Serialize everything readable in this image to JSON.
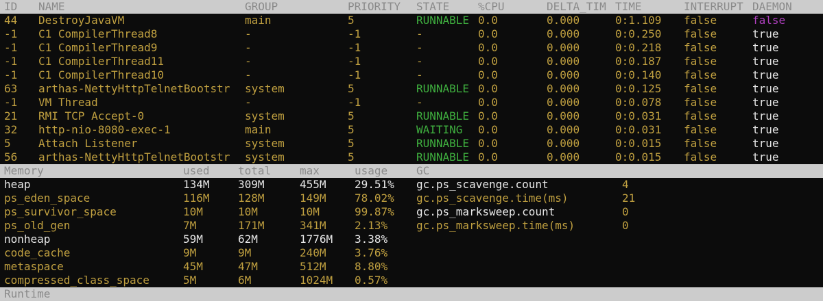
{
  "thread_table": {
    "columns": [
      "ID",
      "NAME",
      "GROUP",
      "PRIORITY",
      "STATE",
      "%CPU",
      "DELTA_TIM",
      "TIME",
      "INTERRUPT",
      "DAEMON"
    ],
    "rows": [
      [
        "44",
        "DestroyJavaVM",
        "main",
        "5",
        "RUNNABLE",
        "0.0",
        "0.000",
        "0:1.109",
        "false",
        "false"
      ],
      [
        "-1",
        "C1 CompilerThread8",
        "-",
        "-1",
        "-",
        "0.0",
        "0.000",
        "0:0.250",
        "false",
        "true"
      ],
      [
        "-1",
        "C1 CompilerThread9",
        "-",
        "-1",
        "-",
        "0.0",
        "0.000",
        "0:0.218",
        "false",
        "true"
      ],
      [
        "-1",
        "C1 CompilerThread11",
        "-",
        "-1",
        "-",
        "0.0",
        "0.000",
        "0:0.187",
        "false",
        "true"
      ],
      [
        "-1",
        "C1 CompilerThread10",
        "-",
        "-1",
        "-",
        "0.0",
        "0.000",
        "0:0.140",
        "false",
        "true"
      ],
      [
        "63",
        "arthas-NettyHttpTelnetBootstr",
        "system",
        "5",
        "RUNNABLE",
        "0.0",
        "0.000",
        "0:0.125",
        "false",
        "true"
      ],
      [
        "-1",
        "VM Thread",
        "-",
        "-1",
        "-",
        "0.0",
        "0.000",
        "0:0.078",
        "false",
        "true"
      ],
      [
        "21",
        "RMI TCP Accept-0",
        "system",
        "5",
        "RUNNABLE",
        "0.0",
        "0.000",
        "0:0.031",
        "false",
        "true"
      ],
      [
        "32",
        "http-nio-8080-exec-1",
        "main",
        "5",
        "WAITING",
        "0.0",
        "0.000",
        "0:0.031",
        "false",
        "true"
      ],
      [
        "5",
        "Attach Listener",
        "system",
        "5",
        "RUNNABLE",
        "0.0",
        "0.000",
        "0:0.015",
        "false",
        "true"
      ],
      [
        "56",
        "arthas-NettyHttpTelnetBootstr",
        "system",
        "5",
        "RUNNABLE",
        "0.0",
        "0.000",
        "0:0.015",
        "false",
        "true"
      ]
    ]
  },
  "memory_table": {
    "columns": [
      "Memory",
      "used",
      "total",
      "max",
      "usage"
    ],
    "rows": [
      [
        "heap",
        "134M",
        "309M",
        "455M",
        "29.51%"
      ],
      [
        "ps_eden_space",
        "116M",
        "128M",
        "149M",
        "78.02%"
      ],
      [
        "ps_survivor_space",
        "10M",
        "10M",
        "10M",
        "99.87%"
      ],
      [
        "ps_old_gen",
        "7M",
        "171M",
        "341M",
        "2.13%"
      ],
      [
        "nonheap",
        "59M",
        "62M",
        "1776M",
        "3.38%"
      ],
      [
        "code_cache",
        "9M",
        "9M",
        "240M",
        "3.76%"
      ],
      [
        "metaspace",
        "45M",
        "47M",
        "512M",
        "8.80%"
      ],
      [
        "compressed_class_space",
        "5M",
        "6M",
        "1024M",
        "0.57%"
      ]
    ]
  },
  "gc_table": {
    "header": "GC",
    "rows": [
      [
        "gc.ps_scavenge.count",
        "4"
      ],
      [
        "gc.ps_scavenge.time(ms)",
        "21"
      ],
      [
        "gc.ps_marksweep.count",
        "0"
      ],
      [
        "gc.ps_marksweep.time(ms)",
        "0"
      ]
    ]
  },
  "runtime_section": {
    "header": "Runtime"
  },
  "colors": {
    "header_bg": "#cccccc",
    "header_text": "#8a8a8a",
    "yellow": "#c0a040",
    "white": "#e8e8e8",
    "green": "#3fb03f",
    "purple": "#b040c0"
  }
}
